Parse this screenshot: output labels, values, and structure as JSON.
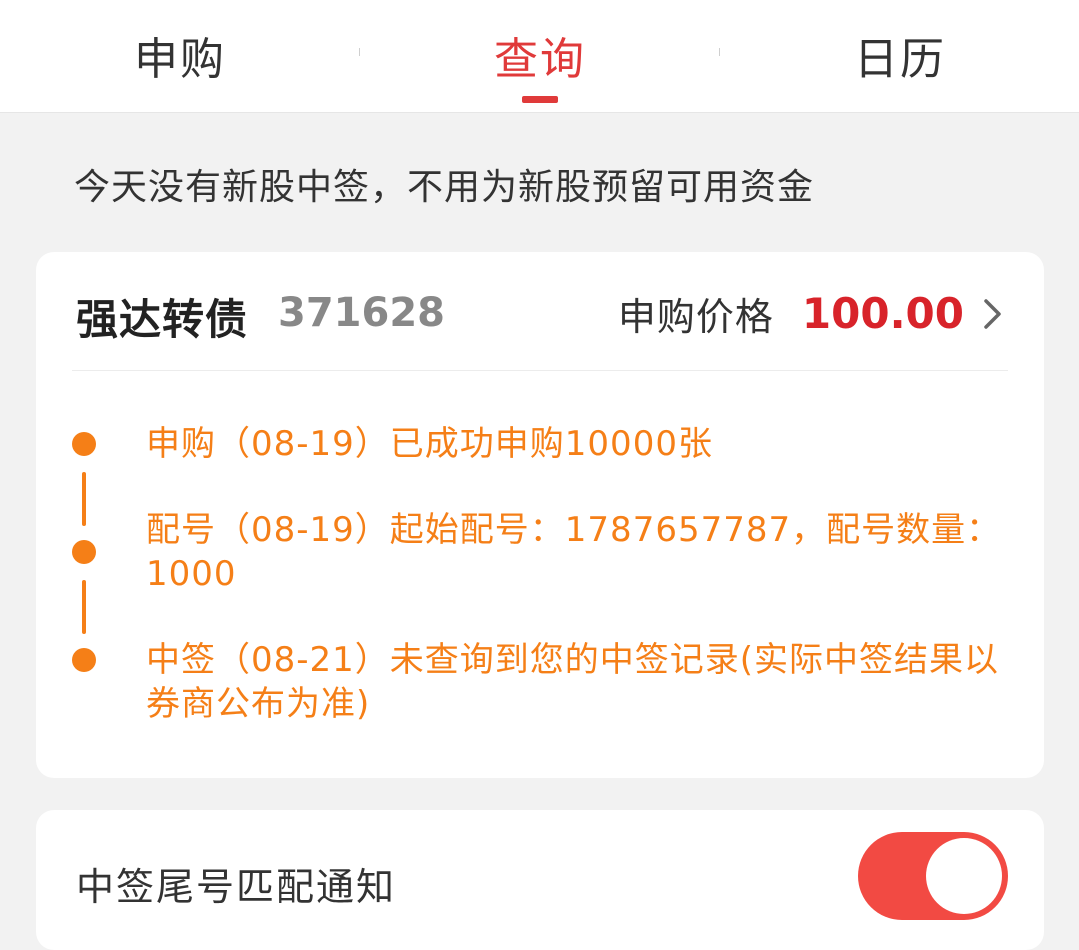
{
  "tabs": [
    {
      "label": "申购",
      "active": false
    },
    {
      "label": "查询",
      "active": true
    },
    {
      "label": "日历",
      "active": false
    }
  ],
  "notice": "今天没有新股中签，不用为新股预留可用资金",
  "bond": {
    "name": "强达转债",
    "code": "371628",
    "price_label": "申购价格",
    "price_value": "100.00",
    "steps": [
      {
        "text": "申购（08-19）已成功申购10000张"
      },
      {
        "text": "配号（08-19）起始配号：1787657787，配号数量：1000"
      },
      {
        "text": "中签（08-21）未查询到您的中签记录(实际中签结果以券商公布为准)"
      }
    ]
  },
  "notify": {
    "label": "中签尾号匹配通知",
    "enabled": true
  },
  "colors": {
    "accent": "#e03a3a",
    "price": "#d8232a",
    "timeline": "#f57f17",
    "toggle_on": "#f24a43"
  },
  "icons": {
    "price_arrow": "chevron-right-icon",
    "step_marker": "dot-icon"
  }
}
